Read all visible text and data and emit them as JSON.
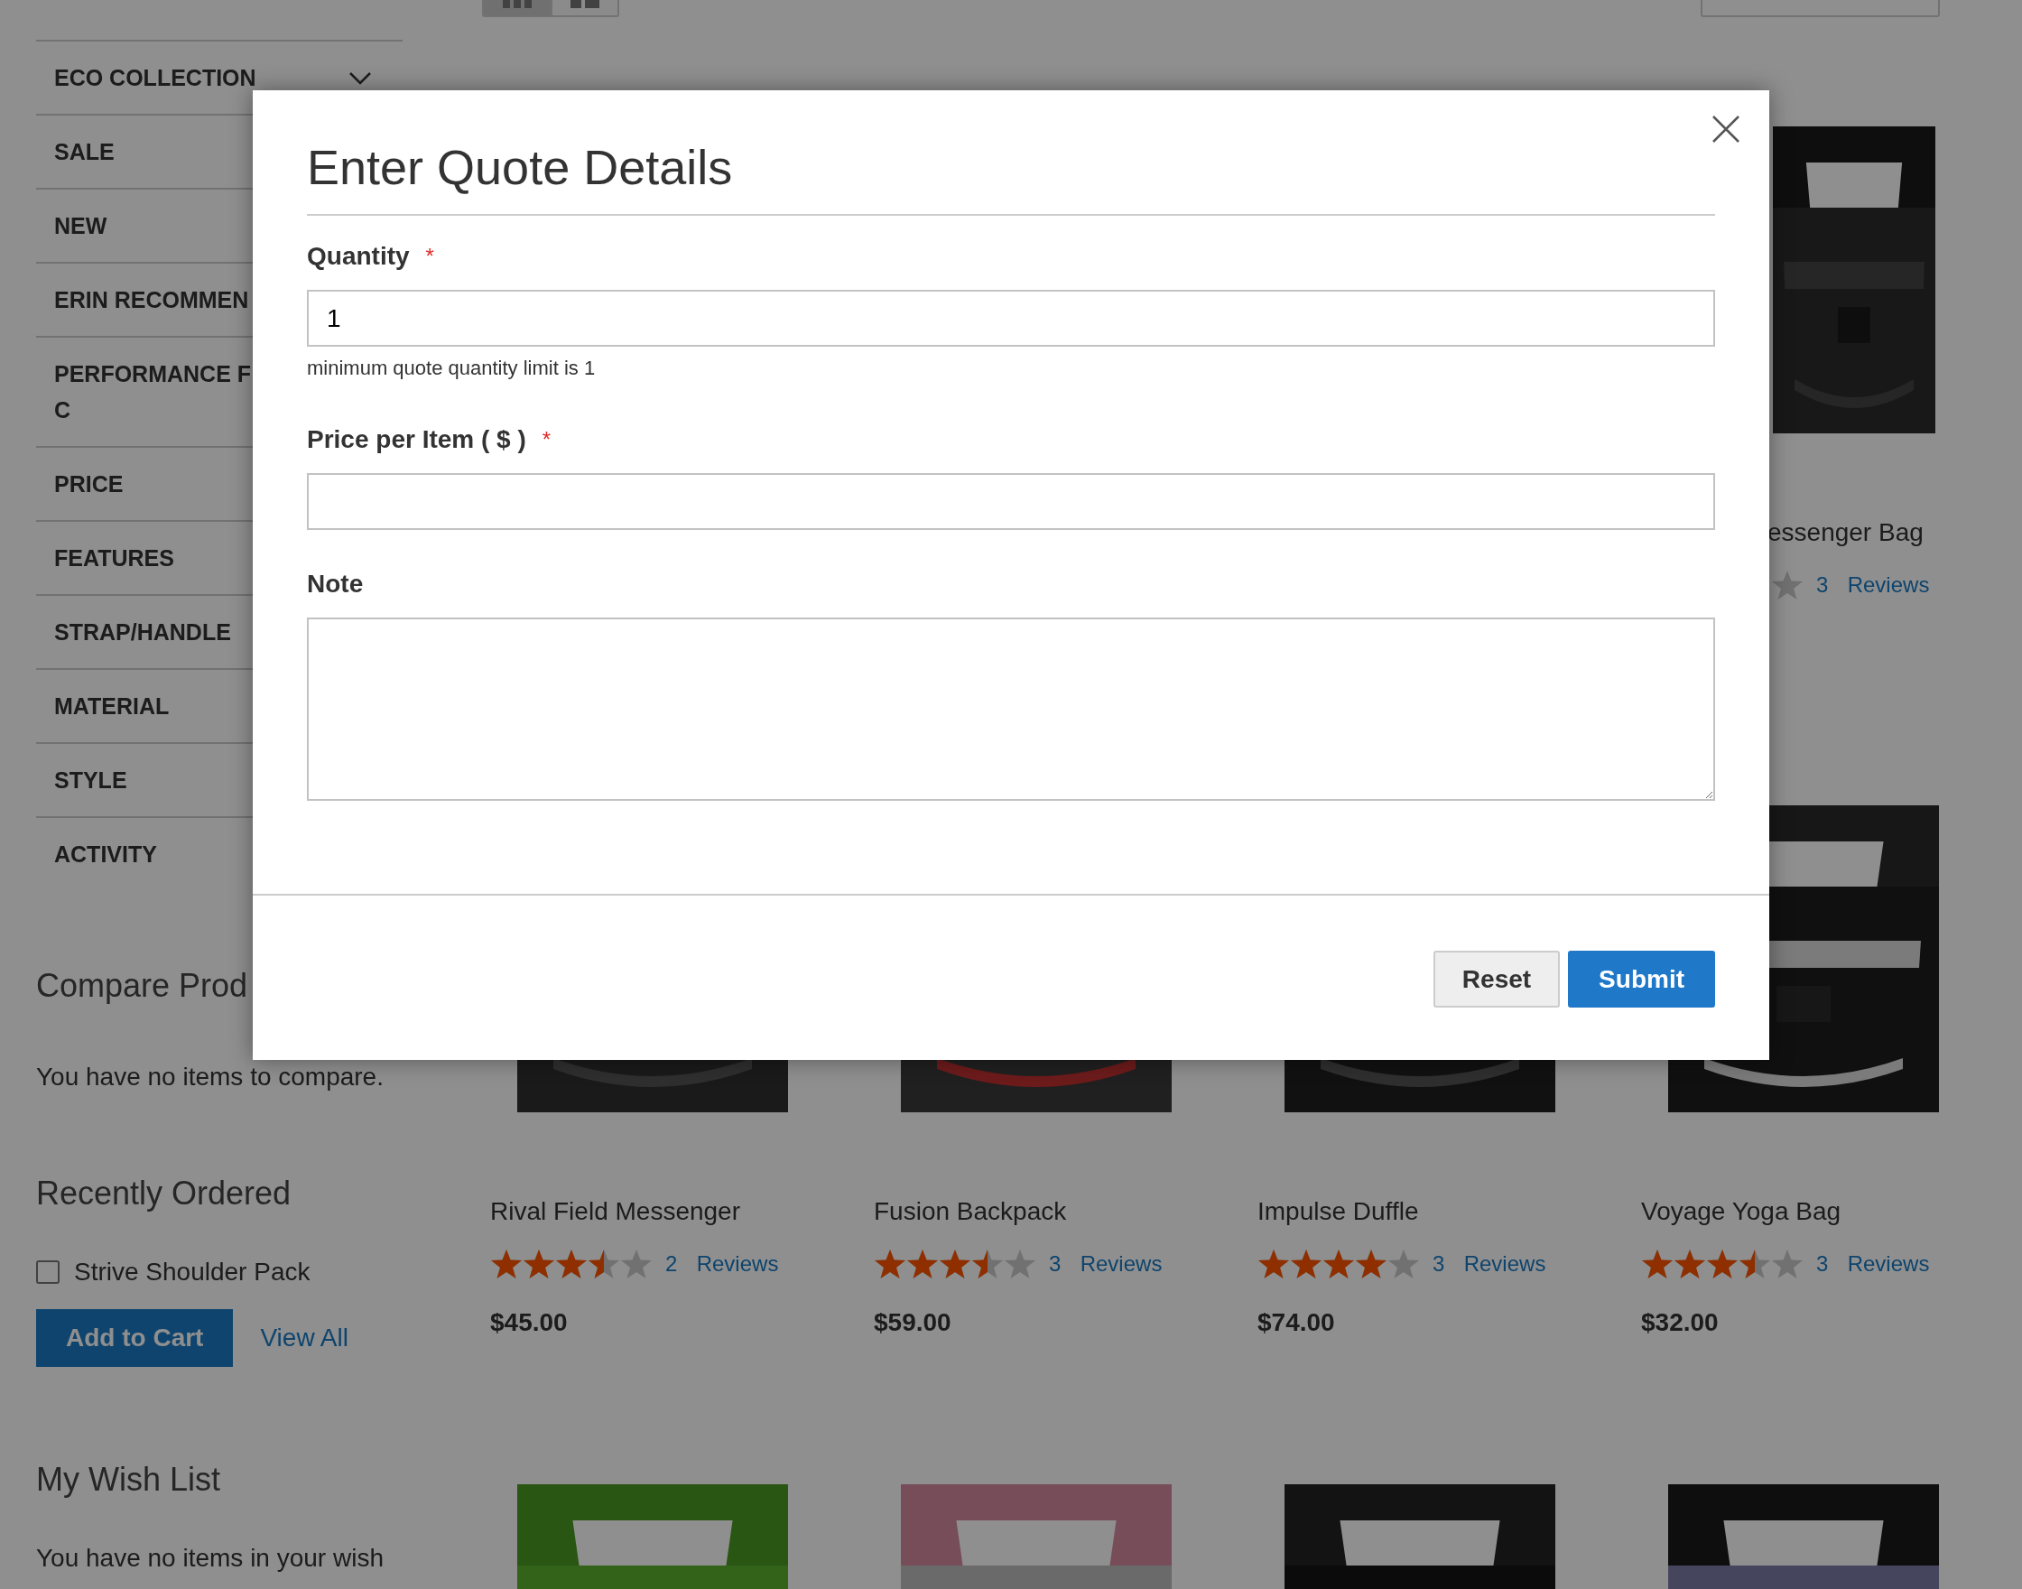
{
  "view_toggle": [
    {
      "kind": "grid",
      "selected": true
    },
    {
      "kind": "list",
      "selected": false
    }
  ],
  "sidebar": {
    "filters": [
      {
        "label": "ECO COLLECTION",
        "expanded": false
      },
      {
        "label": "SALE"
      },
      {
        "label": "NEW"
      },
      {
        "label": "ERIN RECOMMEN"
      },
      {
        "label": "PERFORMANCE F\nC"
      },
      {
        "label": "PRICE"
      },
      {
        "label": "FEATURES"
      },
      {
        "label": "STRAP/HANDLE"
      },
      {
        "label": "MATERIAL"
      },
      {
        "label": "STYLE"
      },
      {
        "label": "ACTIVITY"
      }
    ],
    "compare": {
      "title": "Compare Prod",
      "empty_text": "You have no items to compare."
    },
    "recently_ordered": {
      "title": "Recently Ordered",
      "items": [
        {
          "name": "Strive Shoulder Pack",
          "checked": false
        }
      ],
      "add_button": "Add to Cart",
      "view_all": "View All"
    },
    "wish_list": {
      "title": "My Wish List",
      "empty_text": "You have no items in your wish"
    }
  },
  "product_rows": [
    {
      "items": [
        {
          "kind": "partial",
          "name": "essenger Bag",
          "reviews": "3  Reviews"
        }
      ]
    },
    {
      "items": [
        {
          "kind": "full",
          "name": "Rival Field Messenger",
          "stars": 3.5,
          "reviews": "2  Reviews",
          "price": "$45.00"
        },
        {
          "kind": "full",
          "name": "Fusion Backpack",
          "stars": 3.5,
          "reviews": "3  Reviews",
          "price": "$59.00"
        },
        {
          "kind": "full",
          "name": "Impulse Duffle",
          "stars": 4,
          "reviews": "3  Reviews",
          "price": "$74.00"
        },
        {
          "kind": "full",
          "name": "Voyage Yoga Bag",
          "stars": 3.5,
          "reviews": "3  Reviews",
          "price": "$32.00"
        }
      ]
    },
    {
      "items": [
        {
          "kind": "picture"
        },
        {
          "kind": "picture"
        },
        {
          "kind": "picture"
        },
        {
          "kind": "picture"
        }
      ]
    }
  ],
  "modal": {
    "title": "Enter Quote Details",
    "fields": [
      {
        "kind": "input",
        "label": "Quantity",
        "required_mark": "*",
        "value": "1",
        "hint": "minimum quote quantity limit is 1"
      },
      {
        "kind": "input",
        "label": "Price per Item ( $ )",
        "required_mark": "*"
      },
      {
        "kind": "textarea",
        "label": "Note"
      }
    ],
    "buttons": [
      {
        "label": "Reset",
        "kind": "secondary"
      },
      {
        "label": "Submit",
        "kind": "primary"
      }
    ]
  }
}
